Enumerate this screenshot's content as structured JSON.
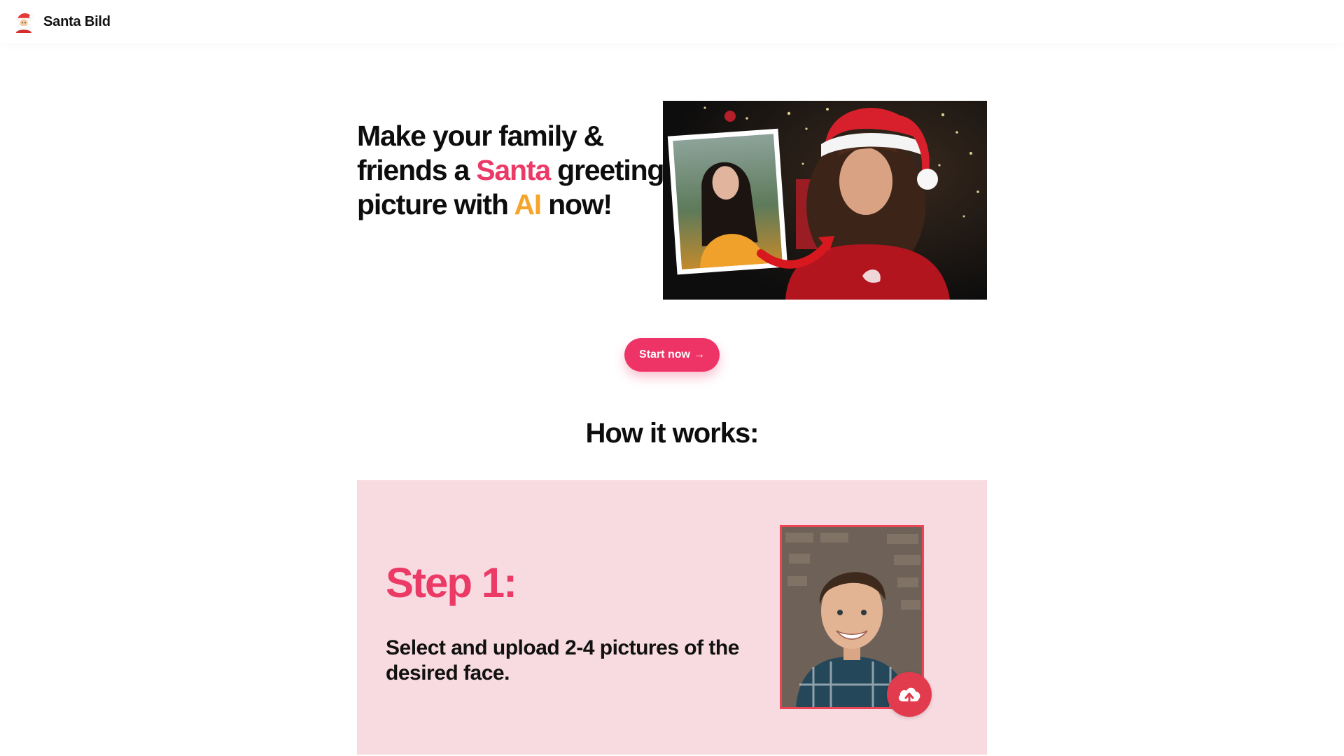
{
  "header": {
    "brand_name": "Santa Bild",
    "brand_icon": "santa-icon"
  },
  "hero": {
    "title_part1": "Make your family & friends a ",
    "title_highlight_santa": "Santa",
    "title_part2": " greeting picture with ",
    "title_highlight_ai": "AI",
    "title_part3": " now!",
    "cta_label": "Start now",
    "cta_arrow": "→"
  },
  "how_it_works": {
    "title": "How it works:",
    "steps": [
      {
        "label": "Step 1:",
        "text": "Select and upload 2-4 pictures of the desired face.",
        "icon": "upload-cloud-icon"
      }
    ]
  },
  "colors": {
    "accent_pink": "#ec3a67",
    "accent_orange": "#f5a52c",
    "step_card_bg": "#f8dbe0",
    "cta_bg": "#ee3466"
  }
}
